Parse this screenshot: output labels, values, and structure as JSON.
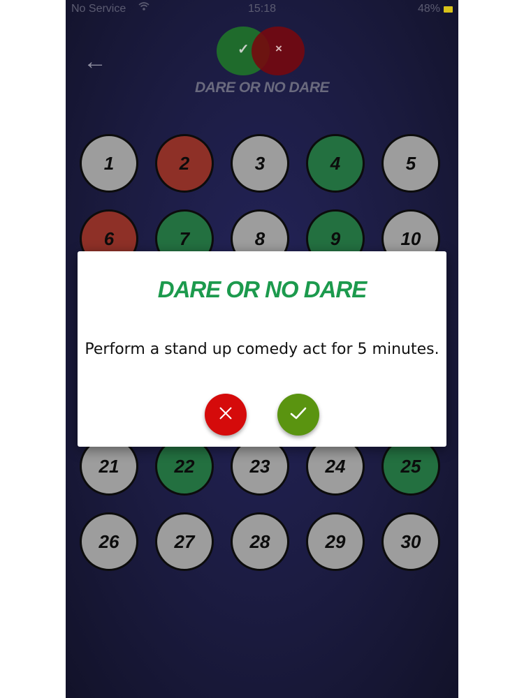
{
  "status_bar": {
    "carrier": "No Service",
    "wifi_icon": "wifi-icon",
    "time": "15:18",
    "battery_percent": "48%",
    "battery_color": "#f0d000"
  },
  "header": {
    "back_icon": "←",
    "logo_check": "✓",
    "logo_cross": "×",
    "title": "DARE OR NO DARE"
  },
  "colors": {
    "gray": "#9d9d9d",
    "red": "#8e3027",
    "green": "#237040",
    "accent_title": "#1c9a4d",
    "reject": "#d50b0b",
    "accept": "#5a9410"
  },
  "grid": {
    "visible_top": [
      {
        "n": "1",
        "state": "gray"
      },
      {
        "n": "2",
        "state": "red"
      },
      {
        "n": "3",
        "state": "gray"
      },
      {
        "n": "4",
        "state": "green"
      },
      {
        "n": "5",
        "state": "gray"
      },
      {
        "n": "6",
        "state": "red"
      },
      {
        "n": "7",
        "state": "green"
      },
      {
        "n": "8",
        "state": "gray"
      },
      {
        "n": "9",
        "state": "green"
      },
      {
        "n": "10",
        "state": "gray"
      }
    ],
    "visible_bottom": [
      {
        "n": "21",
        "state": "gray"
      },
      {
        "n": "22",
        "state": "green"
      },
      {
        "n": "23",
        "state": "gray"
      },
      {
        "n": "24",
        "state": "gray"
      },
      {
        "n": "25",
        "state": "green"
      },
      {
        "n": "26",
        "state": "gray"
      },
      {
        "n": "27",
        "state": "gray"
      },
      {
        "n": "28",
        "state": "gray"
      },
      {
        "n": "29",
        "state": "gray"
      },
      {
        "n": "30",
        "state": "gray"
      }
    ]
  },
  "dialog": {
    "title": "DARE OR NO DARE",
    "message": "Perform a stand up comedy act for 5 minutes.",
    "reject_icon": "close-icon",
    "accept_icon": "check-icon"
  }
}
